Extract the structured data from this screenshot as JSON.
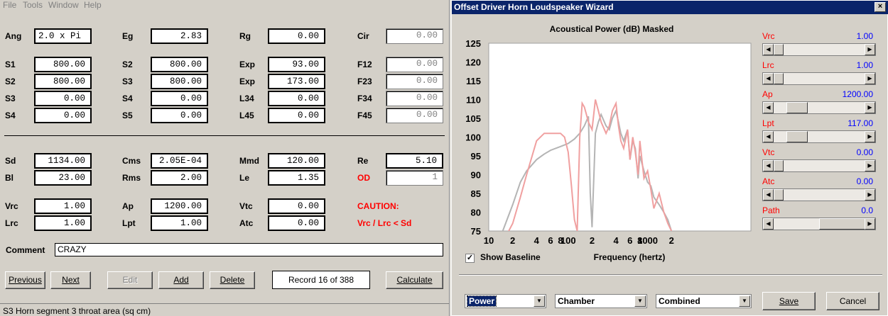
{
  "menu": [
    "File",
    "Tools",
    "Window",
    "Help"
  ],
  "params": {
    "row1": {
      "l1": "Ang",
      "v1": "2.0 x Pi",
      "l2": "Eg",
      "v2": "2.83",
      "l3": "Rg",
      "v3": "0.00",
      "l4": "Cir",
      "v4": "0.00"
    },
    "row2": {
      "l1": "S1",
      "v1": "800.00",
      "l2": "S2",
      "v2": "800.00",
      "l3": "Exp",
      "v3": "93.00",
      "l4": "F12",
      "v4": "0.00"
    },
    "row3": {
      "l1": "S2",
      "v1": "800.00",
      "l2": "S3",
      "v2": "800.00",
      "l3": "Exp",
      "v3": "173.00",
      "l4": "F23",
      "v4": "0.00"
    },
    "row4": {
      "l1": "S3",
      "v1": "0.00",
      "l2": "S4",
      "v2": "0.00",
      "l3": "L34",
      "v3": "0.00",
      "l4": "F34",
      "v4": "0.00"
    },
    "row5": {
      "l1": "S4",
      "v1": "0.00",
      "l2": "S5",
      "v2": "0.00",
      "l3": "L45",
      "v3": "0.00",
      "l4": "F45",
      "v4": "0.00"
    },
    "row6": {
      "l1": "Sd",
      "v1": "1134.00",
      "l2": "Cms",
      "v2": "2.05E-04",
      "l3": "Mmd",
      "v3": "120.00",
      "l4": "Re",
      "v4": "5.10"
    },
    "row7": {
      "l1": "Bl",
      "v1": "23.00",
      "l2": "Rms",
      "v2": "2.00",
      "l3": "Le",
      "v3": "1.35",
      "l4": "OD",
      "v4": "1"
    },
    "row8": {
      "l1": "Vrc",
      "v1": "1.00",
      "l2": "Ap",
      "v2": "1200.00",
      "l3": "Vtc",
      "v3": "0.00",
      "l4": "CAUTION:"
    },
    "row9": {
      "l1": "Lrc",
      "v1": "1.00",
      "l2": "Lpt",
      "v2": "1.00",
      "l3": "Atc",
      "v3": "0.00",
      "l4": "Vrc / Lrc < Sd"
    }
  },
  "comment": {
    "label": "Comment",
    "value": "CRAZY"
  },
  "buttons": {
    "previous": "Previous",
    "next": "Next",
    "edit": "Edit",
    "add": "Add",
    "delete": "Delete",
    "record": "Record 16 of 388",
    "calculate": "Calculate"
  },
  "status": "S3   Horn segment 3 throat area  (sq cm)",
  "wizard": {
    "title": "Offset Driver Horn Loudspeaker Wizard",
    "close": "×",
    "sliders": [
      {
        "label": "Vrc",
        "value": "1.00",
        "pos": 0.0
      },
      {
        "label": "Lrc",
        "value": "1.00",
        "pos": 0.0
      },
      {
        "label": "Ap",
        "value": "1200.00",
        "pos": 0.13
      },
      {
        "label": "Lpt",
        "value": "117.00",
        "pos": 0.13
      },
      {
        "label": "Vtc",
        "value": "0.00",
        "pos": 0.0
      },
      {
        "label": "Atc",
        "value": "0.00",
        "pos": 0.0
      },
      {
        "label": "Path",
        "value": "0.0",
        "pos": 0.46
      }
    ],
    "show_baseline": "Show Baseline",
    "show_baseline_checked": true,
    "selects": {
      "mode": "Power",
      "space": "Chamber",
      "output": "Combined"
    },
    "save": "Save",
    "cancel": "Cancel"
  },
  "chart_data": {
    "type": "line",
    "title": "Acoustical Power (dB)   Masked",
    "xlabel": "Frequency (hertz)",
    "ylabel": "",
    "x_scale": "log",
    "ylim": [
      75,
      125
    ],
    "xlim": [
      10,
      20000
    ],
    "y_ticks": [
      "125",
      "120",
      "115",
      "110",
      "105",
      "100",
      "95",
      "90",
      "85",
      "80",
      "75"
    ],
    "x_ticks": [
      {
        "v": 10,
        "t": "10"
      },
      {
        "v": 20,
        "t": "2"
      },
      {
        "v": 40,
        "t": "4"
      },
      {
        "v": 60,
        "t": "6"
      },
      {
        "v": 80,
        "t": "8"
      },
      {
        "v": 100,
        "t": "100"
      },
      {
        "v": 200,
        "t": "2"
      },
      {
        "v": 400,
        "t": "4"
      },
      {
        "v": 600,
        "t": "6"
      },
      {
        "v": 800,
        "t": "8"
      },
      {
        "v": 1000,
        "t": "1000"
      },
      {
        "v": 2000,
        "t": "2"
      }
    ],
    "grid": false,
    "series": [
      {
        "color": "#b4b4b4",
        "x": [
          15,
          20,
          25,
          30,
          40,
          50,
          60,
          80,
          100,
          120,
          140,
          160,
          180,
          190,
          200,
          220,
          240,
          260,
          300,
          330,
          360,
          400,
          430,
          460,
          500,
          560,
          600,
          650,
          700,
          760,
          800,
          900,
          1000,
          1100,
          1200,
          1400,
          1600,
          1800,
          2000
        ],
        "y": [
          75,
          82,
          88,
          91,
          94,
          95.5,
          96.5,
          97.5,
          98.3,
          99.5,
          101,
          103,
          105.5,
          85,
          76,
          101,
          104,
          106,
          103,
          102,
          105,
          107,
          104,
          101,
          99,
          102,
          94,
          99,
          97,
          89,
          95,
          91,
          88,
          87,
          84,
          82,
          80,
          78,
          75
        ]
      },
      {
        "color": "#f0a0a0",
        "x": [
          12,
          15,
          20,
          25,
          30,
          40,
          50,
          60,
          70,
          80,
          90,
          100,
          110,
          120,
          130,
          140,
          150,
          160,
          170,
          180,
          200,
          220,
          240,
          260,
          300,
          330,
          360,
          400,
          430,
          460,
          500,
          560,
          600,
          650,
          700,
          760,
          800,
          900,
          1000,
          1100,
          1200,
          1400,
          1600,
          1800,
          2000
        ],
        "y": [
          70,
          72,
          77,
          84,
          90,
          99,
          101,
          101,
          101,
          101,
          100,
          96,
          87,
          78,
          75,
          100,
          109,
          108,
          106,
          104,
          102,
          110,
          107,
          104,
          101,
          103,
          107,
          109,
          103,
          99,
          97,
          102,
          94,
          100,
          96,
          90,
          99,
          89,
          91,
          86,
          81,
          85,
          80,
          77,
          75
        ]
      }
    ]
  }
}
